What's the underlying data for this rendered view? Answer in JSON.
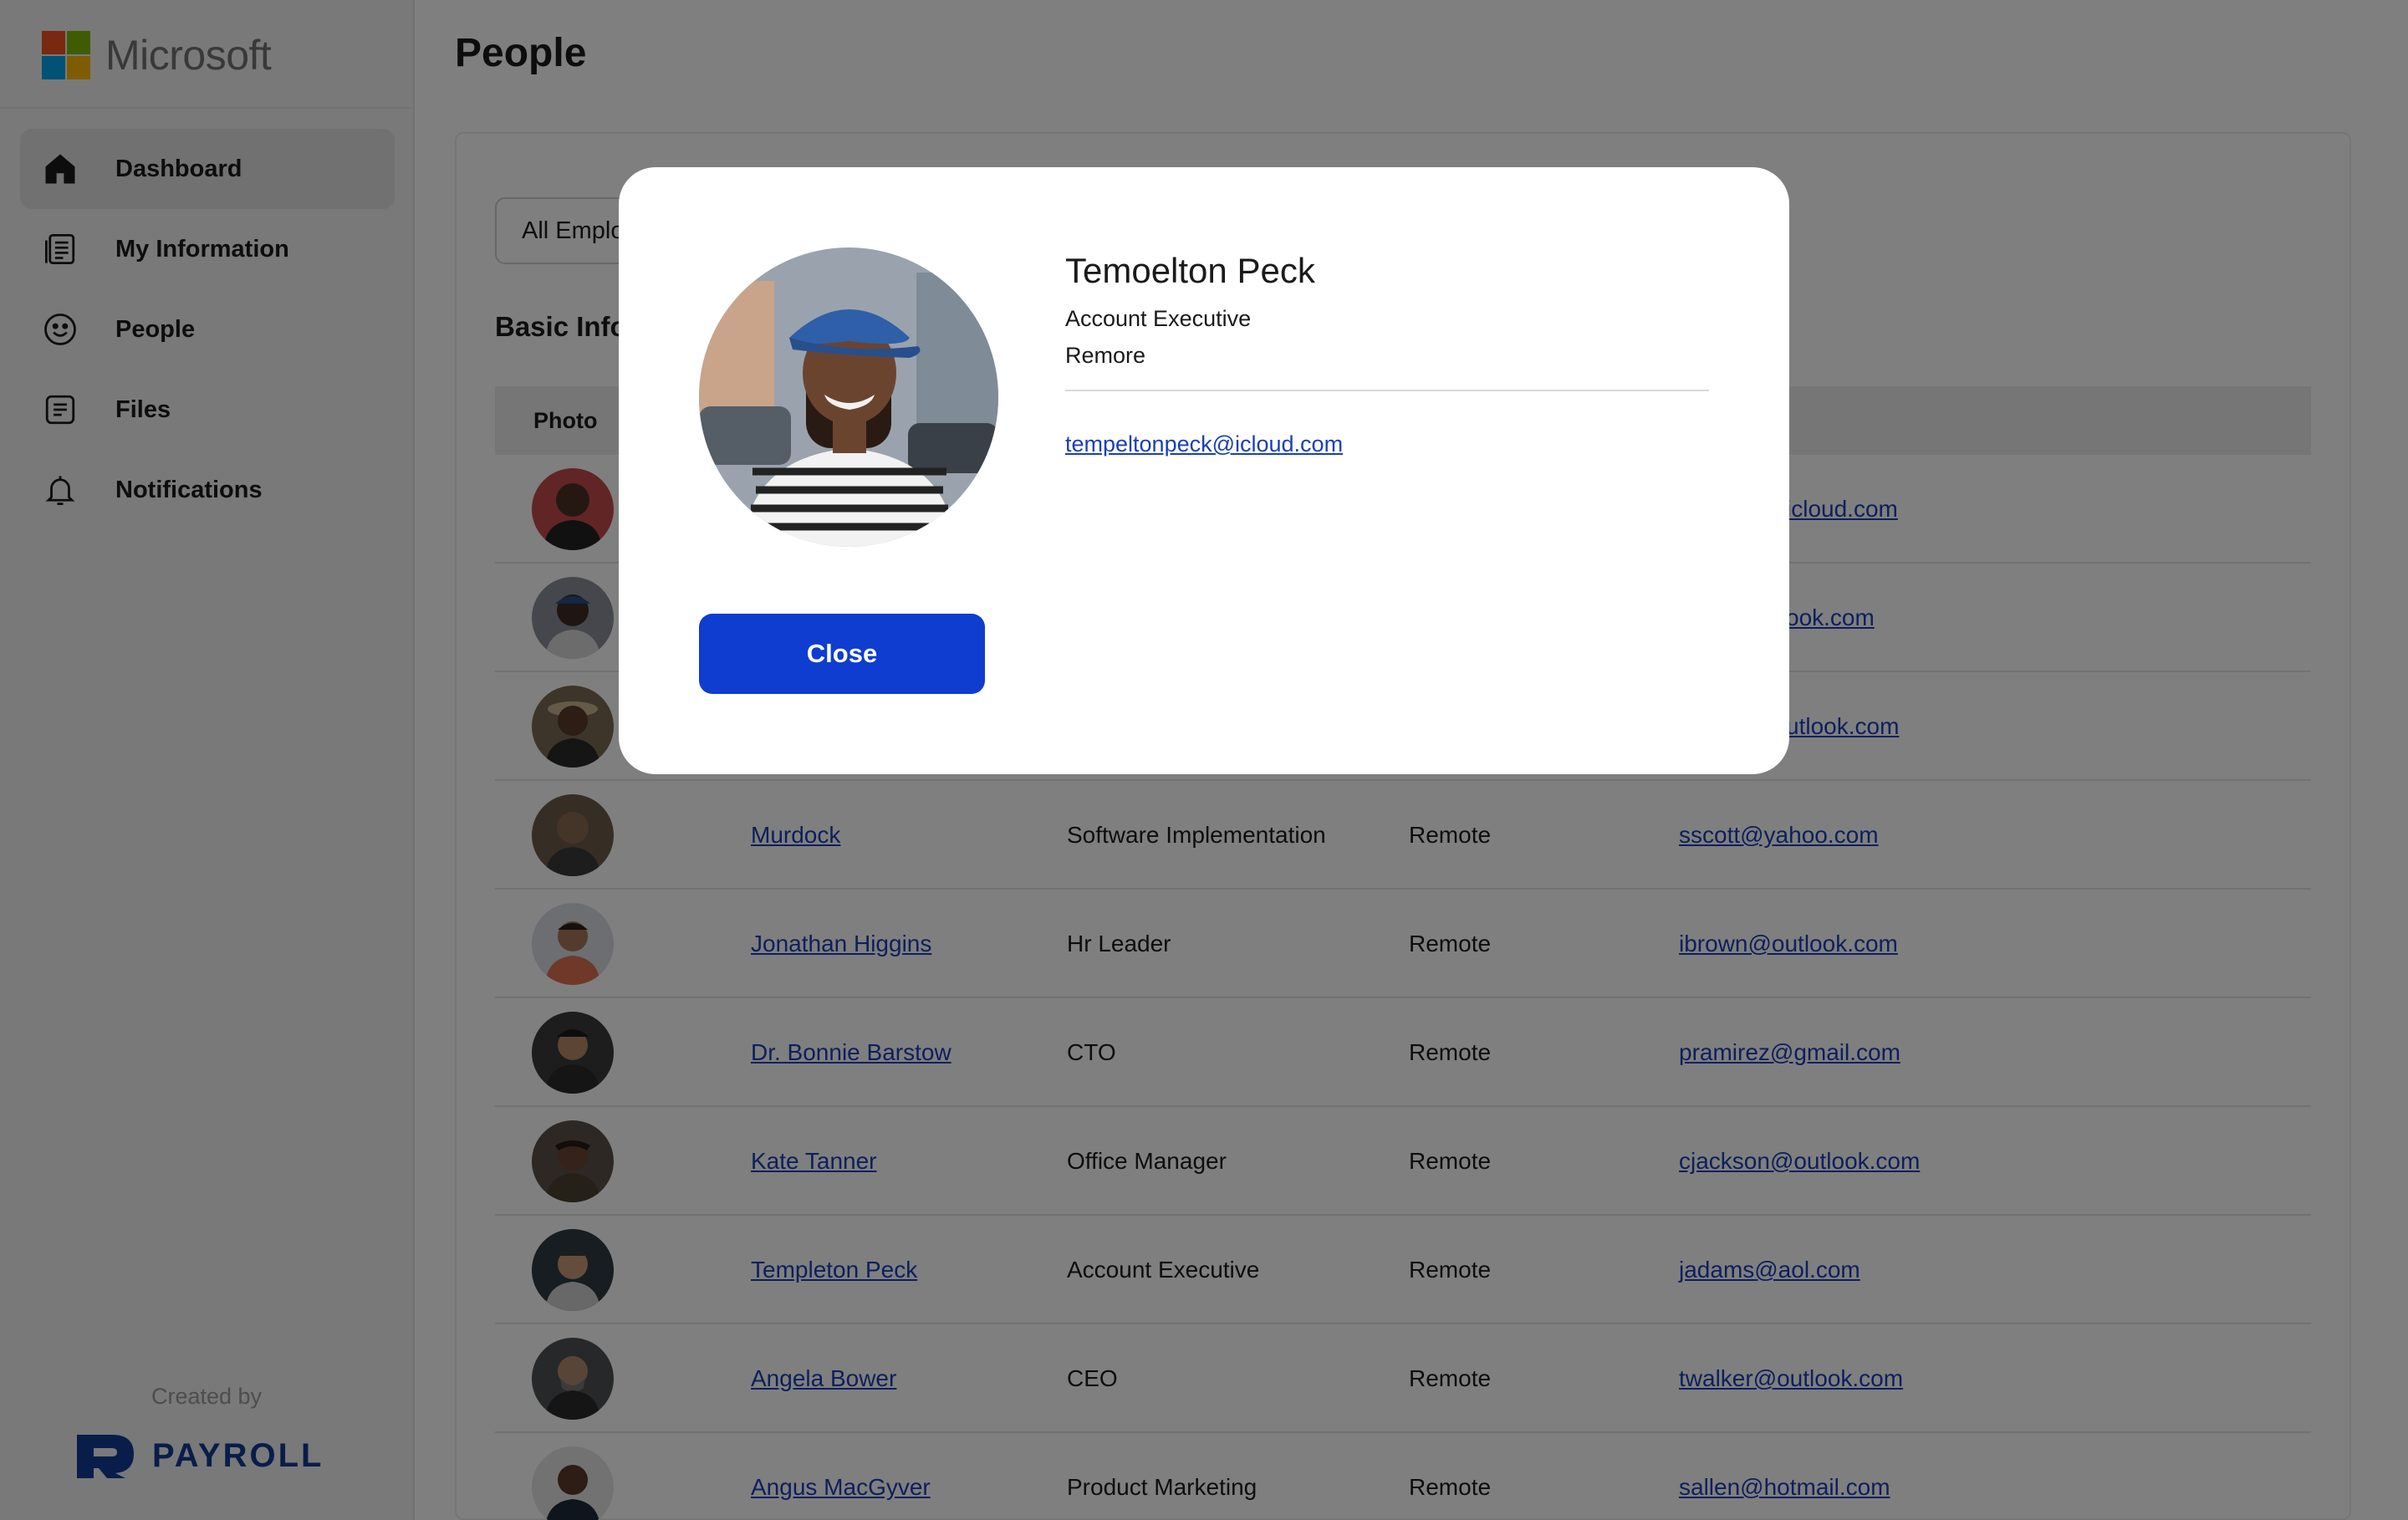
{
  "brand": {
    "name": "Microsoft",
    "colors": [
      "#f25022",
      "#7fba00",
      "#00a4ef",
      "#ffb900"
    ]
  },
  "sidebar": {
    "items": [
      {
        "label": "Dashboard",
        "icon": "home-icon",
        "active": true
      },
      {
        "label": "My Information",
        "icon": "document-list-icon",
        "active": false
      },
      {
        "label": "People",
        "icon": "smiley-icon",
        "active": false
      },
      {
        "label": "Files",
        "icon": "file-icon",
        "active": false
      },
      {
        "label": "Notifications",
        "icon": "bell-icon",
        "active": false
      }
    ],
    "created_by": "Created by",
    "payroll_logo": "PAYROLL"
  },
  "page": {
    "title": "People"
  },
  "filter": {
    "value": "All Employees"
  },
  "section": {
    "title": "Basic Information"
  },
  "table": {
    "headers": [
      "Photo"
    ],
    "rows": [
      {
        "name": "",
        "title": "",
        "location": "",
        "email": "icloud.com"
      },
      {
        "name": "",
        "title": "",
        "location": "",
        "email": "ook.com"
      },
      {
        "name": "",
        "title": "",
        "location": "",
        "email": "utlook.com"
      },
      {
        "name": "Murdock",
        "title": "Software Implementation",
        "location": "Remote",
        "email": "sscott@yahoo.com"
      },
      {
        "name": "Jonathan Higgins",
        "title": "Hr Leader",
        "location": "Remote",
        "email": "ibrown@outlook.com"
      },
      {
        "name": "Dr. Bonnie Barstow",
        "title": "CTO",
        "location": "Remote",
        "email": "pramirez@gmail.com"
      },
      {
        "name": "Kate Tanner",
        "title": "Office Manager",
        "location": "Remote",
        "email": "cjackson@outlook.com"
      },
      {
        "name": "Templeton Peck",
        "title": "Account Executive",
        "location": "Remote",
        "email": "jadams@aol.com"
      },
      {
        "name": "Angela Bower",
        "title": "CEO",
        "location": "Remote",
        "email": "twalker@outlook.com"
      },
      {
        "name": "Angus MacGyver",
        "title": "Product Marketing",
        "location": "Remote",
        "email": "sallen@hotmail.com"
      }
    ]
  },
  "modal": {
    "name": "Temoelton Peck",
    "title": "Account Executive",
    "location": "Remore",
    "email": "tempeltonpeck@icloud.com",
    "close_label": "Close"
  },
  "colors": {
    "accent": "#0f3dd0",
    "link": "#1a3fb8",
    "payroll": "#123a96"
  }
}
